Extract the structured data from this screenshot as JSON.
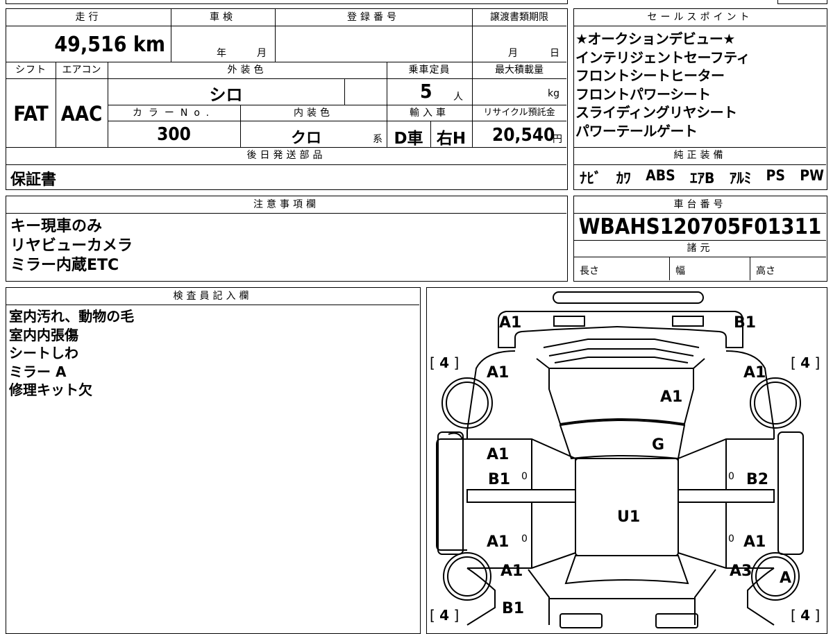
{
  "header": {
    "mileage_label": "走行",
    "shaken_label": "車検",
    "reg_label": "登録番号",
    "transfer_label": "譲渡書類期限",
    "mileage": "49,516 km",
    "shaken_year": "年",
    "shaken_month": "月",
    "transfer_month": "月",
    "transfer_day": "日",
    "shift_label": "シフト",
    "ac_label": "エアコン",
    "ext_color_label": "外装色",
    "capacity_label": "乗車定員",
    "max_load_label": "最大積載量",
    "shift": "FAT",
    "ac": "AAC",
    "ext_color": "シロ",
    "capacity": "5",
    "capacity_unit": "人",
    "load_unit": "kg",
    "color_no_label": "カラーNo.",
    "int_color_label": "内装色",
    "import_label": "輸入車",
    "recycle_label": "リサイクル預託金",
    "color_no": "300",
    "int_color": "クロ",
    "int_color_unit": "系",
    "import_dealer": "D車",
    "handle": "右H",
    "recycle_fee": "20,540",
    "recycle_unit": "円",
    "later_parts_label": "後日発送部品",
    "later_parts": "保証書"
  },
  "sales": {
    "label": "セールスポイント",
    "points": [
      "★オークションデビュー★",
      "インテリジェントセーフティ",
      "フロントシートヒーター",
      "フロントパワーシート",
      "スライディングリヤシート",
      "パワーテールゲート"
    ]
  },
  "equipment": {
    "label": "純正装備",
    "items": [
      "ﾅﾋﾞ",
      "ｶﾜ",
      "ABS",
      "ｴｱB",
      "ｱﾙﾐ",
      "PS",
      "PW"
    ]
  },
  "notes": {
    "label": "注意事項欄",
    "lines": [
      "キー現車のみ",
      "リヤビューカメラ",
      "ミラー内蔵ETC"
    ]
  },
  "chassis": {
    "label": "車台番号",
    "number": "WBAHS120705F01311",
    "specs_label": "諸元",
    "length_label": "長さ",
    "width_label": "幅",
    "height_label": "高さ"
  },
  "inspector": {
    "label": "検査員記入欄",
    "lines": [
      "室内汚れ、動物の毛",
      "室内内張傷",
      "シートしわ",
      "ミラー A",
      "修理キット欠"
    ]
  },
  "diagram": {
    "marks": {
      "front_left": "A1",
      "front_right": "B1",
      "fender_left": "A1",
      "fender_right": "A1",
      "hood": "A1",
      "windshield": "G",
      "front_door_left_1": "A1",
      "front_door_left_2": "B1",
      "front_door_right": "B2",
      "roof": "U1",
      "rear_door_left": "A1",
      "rear_door_right": "A1",
      "quarter_left": "A1",
      "quarter_right": "A3",
      "rear_left": "B1",
      "tire_rear_right": "A"
    },
    "tire_tl": "4",
    "tire_tr": "4",
    "tire_bl": "4",
    "tire_br": "4",
    "zero": "0"
  }
}
